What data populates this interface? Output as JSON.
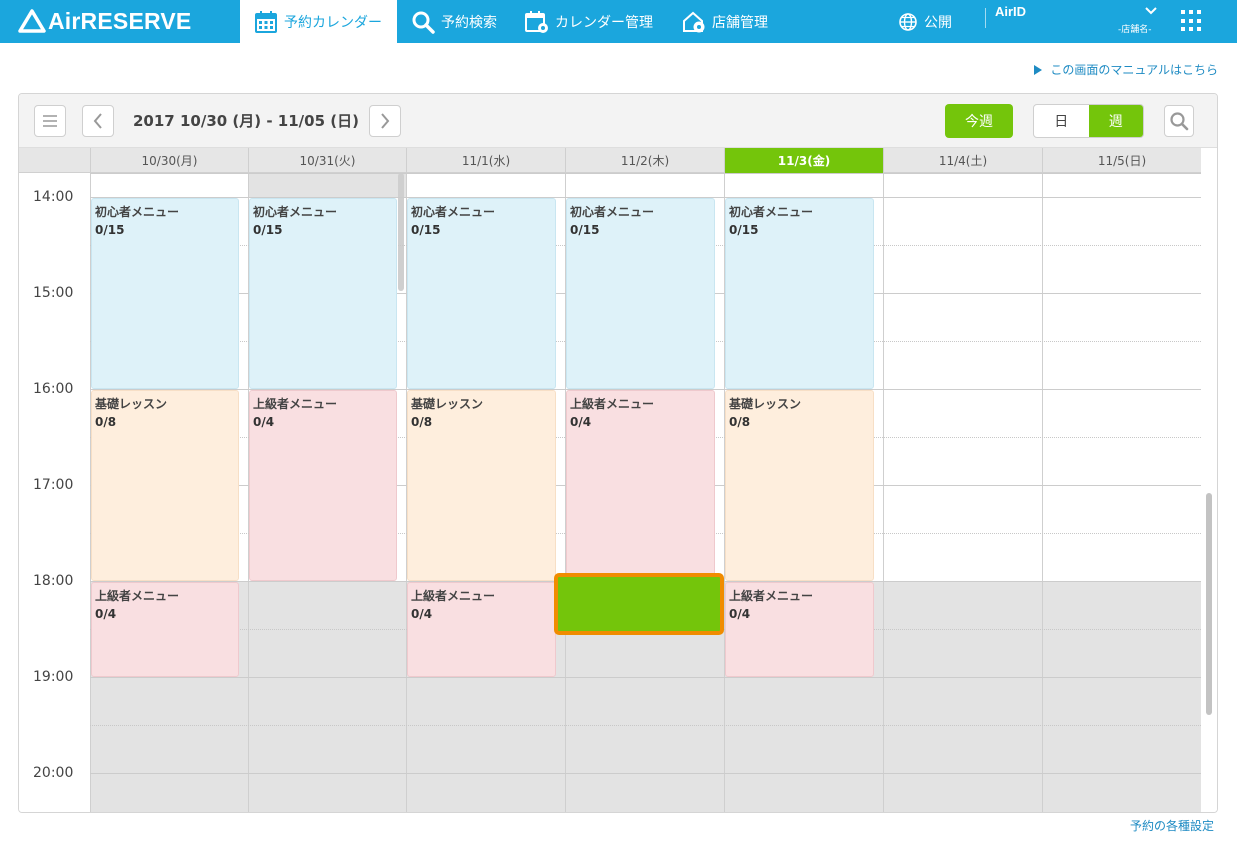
{
  "app": {
    "logo": "AirRESERVE"
  },
  "nav": {
    "items": [
      {
        "label": "予約カレンダー",
        "icon": "calendar-icon",
        "active": true
      },
      {
        "label": "予約検索",
        "icon": "search-icon"
      },
      {
        "label": "カレンダー管理",
        "icon": "calendar-gear-icon"
      },
      {
        "label": "店舗管理",
        "icon": "store-gear-icon"
      }
    ],
    "public_label": "公開",
    "airid": "AirID",
    "store_name": "-店舗名-"
  },
  "manual_link": "この画面のマニュアルはこちら",
  "toolbar": {
    "range": "2017 10/30 (月) - 11/05 (日)",
    "today": "今週",
    "view_day": "日",
    "view_week": "週"
  },
  "days": [
    {
      "label": "10/30(月)"
    },
    {
      "label": "10/31(火)"
    },
    {
      "label": "11/1(水)"
    },
    {
      "label": "11/2(木)"
    },
    {
      "label": "11/3(金)",
      "today": true
    },
    {
      "label": "11/4(土)"
    },
    {
      "label": "11/5(日)"
    }
  ],
  "times": [
    "14:00",
    "15:00",
    "16:00",
    "17:00",
    "18:00",
    "19:00",
    "20:00"
  ],
  "events": [
    {
      "day": 0,
      "start": 14,
      "end": 16,
      "name": "初心者メニュー",
      "count": "0/15",
      "color": "blue"
    },
    {
      "day": 1,
      "start": 14,
      "end": 16,
      "name": "初心者メニュー",
      "count": "0/15",
      "color": "blue"
    },
    {
      "day": 2,
      "start": 14,
      "end": 16,
      "name": "初心者メニュー",
      "count": "0/15",
      "color": "blue"
    },
    {
      "day": 3,
      "start": 14,
      "end": 16,
      "name": "初心者メニュー",
      "count": "0/15",
      "color": "blue"
    },
    {
      "day": 4,
      "start": 14,
      "end": 16,
      "name": "初心者メニュー",
      "count": "0/15",
      "color": "blue"
    },
    {
      "day": 0,
      "start": 16,
      "end": 18,
      "name": "基礎レッスン",
      "count": "0/8",
      "color": "orange"
    },
    {
      "day": 1,
      "start": 16,
      "end": 18,
      "name": "上級者メニュー",
      "count": "0/4",
      "color": "pink"
    },
    {
      "day": 2,
      "start": 16,
      "end": 18,
      "name": "基礎レッスン",
      "count": "0/8",
      "color": "orange"
    },
    {
      "day": 3,
      "start": 16,
      "end": 18,
      "name": "上級者メニュー",
      "count": "0/4",
      "color": "pink"
    },
    {
      "day": 4,
      "start": 16,
      "end": 18,
      "name": "基礎レッスン",
      "count": "0/8",
      "color": "orange"
    },
    {
      "day": 0,
      "start": 18,
      "end": 19,
      "name": "上級者メニュー",
      "count": "0/4",
      "color": "pink"
    },
    {
      "day": 2,
      "start": 18,
      "end": 19,
      "name": "上級者メニュー",
      "count": "0/4",
      "color": "pink"
    },
    {
      "day": 4,
      "start": 18,
      "end": 19,
      "name": "上級者メニュー",
      "count": "0/4",
      "color": "pink"
    }
  ],
  "selected_slot": {
    "day": 3,
    "start": 18,
    "end": 18.5
  },
  "settings_link": "予約の各種設定",
  "colors": {
    "brand": "#1ba6dd",
    "accent": "#74c50b",
    "highlight": "#f08c00"
  }
}
